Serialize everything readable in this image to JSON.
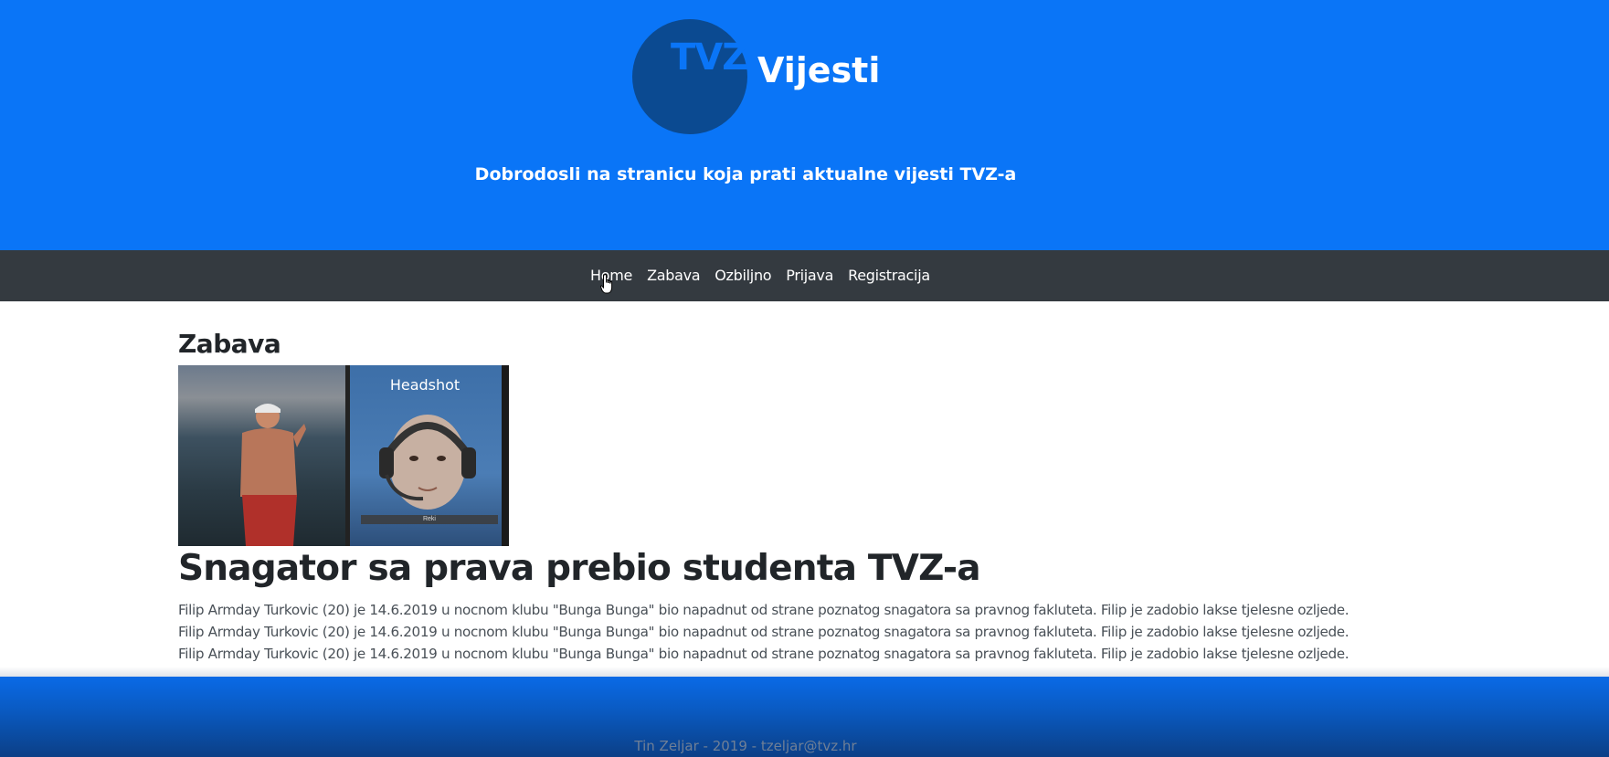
{
  "header": {
    "logo_mark": "TVZ",
    "logo_word": "Vijesti",
    "tagline": "Dobrodosli na stranicu koja prati aktualne vijesti TVZ-a",
    "background_color": "#0a75f7",
    "logo_circle_color": "#0b4a91"
  },
  "nav": {
    "background_color": "#343a40",
    "items": [
      {
        "label": "Home"
      },
      {
        "label": "Zabava"
      },
      {
        "label": "Ozbiljno"
      },
      {
        "label": "Prijava"
      },
      {
        "label": "Registracija"
      }
    ]
  },
  "main": {
    "section_title": "Zabava",
    "article": {
      "image_overlay_text": "Headshot",
      "image_caption": "Reki",
      "title": "Snagator sa prava prebio studenta TVZ-a",
      "paragraphs": [
        "Filip Armday Turkovic (20) je 14.6.2019 u nocnom klubu \"Bunga Bunga\" bio napadnut od strane poznatog snagatora sa pravnog fakluteta. Filip je zadobio lakse tjelesne ozljede.",
        "Filip Armday Turkovic (20) je 14.6.2019 u nocnom klubu \"Bunga Bunga\" bio napadnut od strane poznatog snagatora sa pravnog fakluteta. Filip je zadobio lakse tjelesne ozljede.",
        "Filip Armday Turkovic (20) je 14.6.2019 u nocnom klubu \"Bunga Bunga\" bio napadnut od strane poznatog snagatora sa pravnog fakluteta. Filip je zadobio lakse tjelesne ozljede."
      ]
    }
  },
  "footer": {
    "text": "Tin Zeljar - 2019 - tzeljar@tvz.hr"
  },
  "icons": {
    "cursor": "hand-pointer-icon"
  }
}
